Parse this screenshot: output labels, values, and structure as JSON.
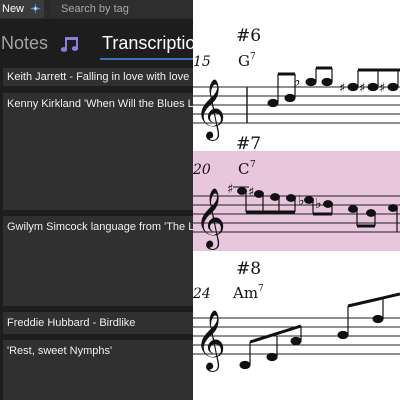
{
  "toolbar": {
    "new_label": "New",
    "new_icon": "sparkle-icon",
    "search_placeholder": "Search by tag"
  },
  "tabs": [
    {
      "label": "Notes",
      "icon": "music-note-icon",
      "active": false
    },
    {
      "label": "Transcriptions",
      "active": true
    }
  ],
  "cards": [
    {
      "title": "Keith Jarrett - Falling in love with love"
    },
    {
      "title": "Kenny Kirkland 'When Will the Blues Leave'"
    },
    {
      "title": "Gwilym Simcock language from 'The Lake'"
    },
    {
      "title": "Freddie Hubbard - Birdlike"
    },
    {
      "title": "'Rest, sweet Nymphs'"
    }
  ],
  "sheet": {
    "highlight_color": "#e8c6de",
    "systems": [
      {
        "section": "#6",
        "bar_number": "15",
        "chord": "G",
        "chord_ext": "7",
        "highlighted": false
      },
      {
        "section": "#7",
        "bar_number": "20",
        "chord": "C",
        "chord_ext": "7",
        "highlighted": true
      },
      {
        "section": "#8",
        "bar_number": "24",
        "chord": "Am",
        "chord_ext": "7",
        "highlighted": false
      }
    ]
  },
  "colors": {
    "panel_bg": "#1d1d1d",
    "card_bg": "#303030",
    "accent": "#3d6fb5"
  }
}
